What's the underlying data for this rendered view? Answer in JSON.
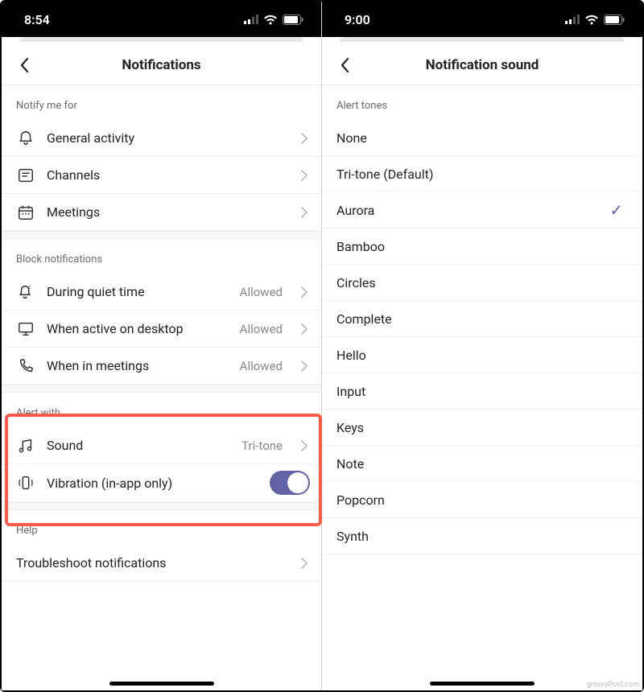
{
  "left": {
    "status": {
      "time": "8:54"
    },
    "title": "Notifications",
    "sections": {
      "notify_header": "Notify me for",
      "notify": [
        {
          "icon": "bell-icon",
          "label": "General activity"
        },
        {
          "icon": "channel-icon",
          "label": "Channels"
        },
        {
          "icon": "calendar-icon",
          "label": "Meetings"
        }
      ],
      "block_header": "Block notifications",
      "block": [
        {
          "icon": "quiet-icon",
          "label": "During quiet time",
          "value": "Allowed"
        },
        {
          "icon": "desktop-icon",
          "label": "When active on desktop",
          "value": "Allowed"
        },
        {
          "icon": "phone-icon",
          "label": "When in meetings",
          "value": "Allowed"
        }
      ],
      "alert_header": "Alert with",
      "alert_sound": {
        "icon": "music-icon",
        "label": "Sound",
        "value": "Tri-tone"
      },
      "alert_vibration": {
        "icon": "vibrate-icon",
        "label": "Vibration (in-app only)",
        "on": true
      },
      "help_header": "Help",
      "help_item": {
        "label": "Troubleshoot notifications"
      }
    }
  },
  "right": {
    "status": {
      "time": "9:00"
    },
    "title": "Notification sound",
    "section_header": "Alert tones",
    "tones": [
      {
        "label": "None",
        "selected": false
      },
      {
        "label": "Tri-tone (Default)",
        "selected": false
      },
      {
        "label": "Aurora",
        "selected": true
      },
      {
        "label": "Bamboo",
        "selected": false
      },
      {
        "label": "Circles",
        "selected": false
      },
      {
        "label": "Complete",
        "selected": false
      },
      {
        "label": "Hello",
        "selected": false
      },
      {
        "label": "Input",
        "selected": false
      },
      {
        "label": "Keys",
        "selected": false
      },
      {
        "label": "Note",
        "selected": false
      },
      {
        "label": "Popcorn",
        "selected": false
      },
      {
        "label": "Synth",
        "selected": false
      }
    ]
  },
  "colors": {
    "accent": "#6264a7",
    "highlight": "#ff5a4a"
  },
  "watermark": "groovyPost.com"
}
